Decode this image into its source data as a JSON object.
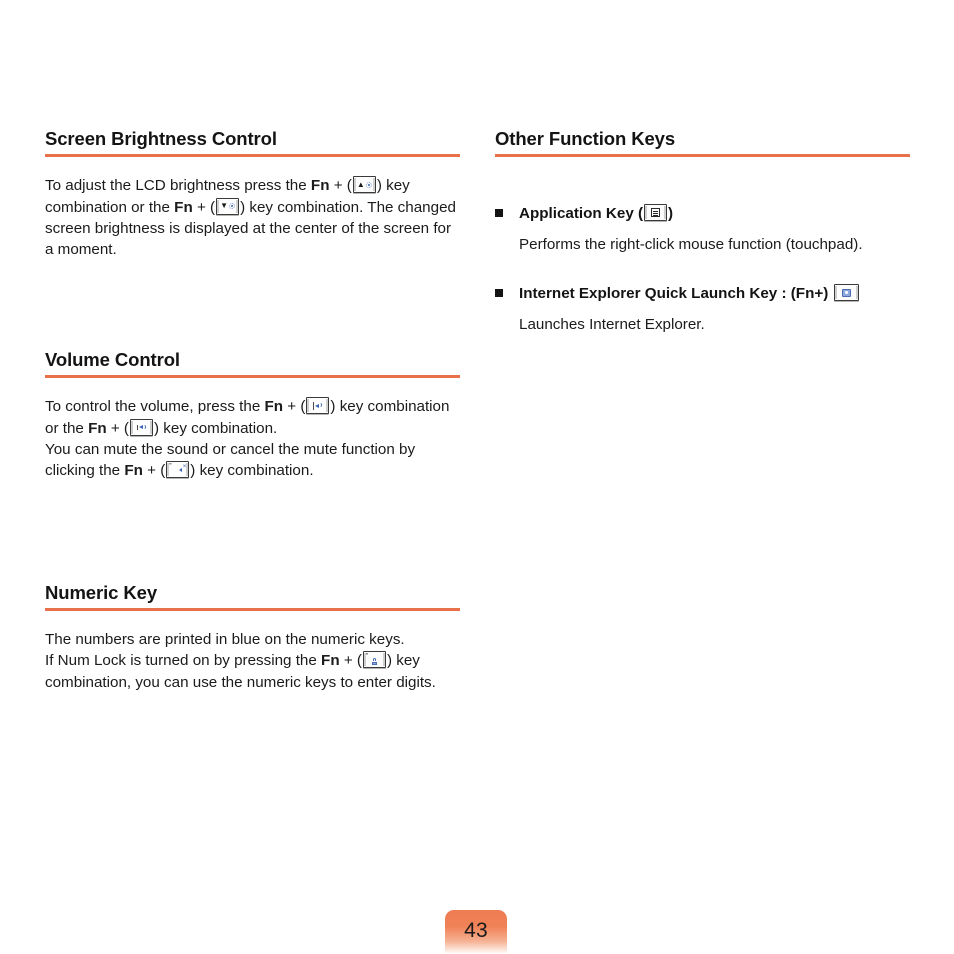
{
  "document": {
    "page_number": "43",
    "accent_color": "#e8714a",
    "text_color": "#1b1b1b"
  },
  "left_column": {
    "sections": [
      {
        "title": "Screen Brightness Control",
        "paragraph_parts": {
          "p1": "To adjust the LCD brightness press the ",
          "fn1": "Fn",
          "plus1": " + (",
          "key1_name": "brightness-up-key-icon",
          "mid": ") key combination or the ",
          "fn2": "Fn",
          "plus2": " + (",
          "key2_name": "brightness-down-key-icon",
          "tail": ") key combination. The changed screen brightness is displayed at the center of the screen for a moment."
        }
      },
      {
        "title": "Volume Control",
        "paragraph_parts": {
          "p1": "To control the volume, press the ",
          "fn1": "Fn",
          "plus1": " + (",
          "key1_name": "volume-up-key-icon",
          "mid": ") key combination or the ",
          "fn2": "Fn",
          "plus2": " + (",
          "key2_name": "volume-down-key-icon",
          "mid2": ") key combination.",
          "line3": "You can mute the sound or cancel the mute function by clicking the ",
          "fn3": "Fn",
          "plus3": " + (",
          "key3_name": "mute-key-icon",
          "tail": ") key combination."
        }
      },
      {
        "title": "Numeric Key",
        "paragraph_parts": {
          "p1": "The numbers are printed in blue on the numeric keys.",
          "p2": "If Num Lock is turned on by pressing the ",
          "fn1": "Fn",
          "plus1": " + (",
          "key1_name": "num-lock-key-icon",
          "tail": ") key combination, you can use the numeric keys to enter digits."
        }
      }
    ]
  },
  "right_column": {
    "section": {
      "title": "Other Function Keys",
      "bullets": [
        {
          "title": "Application Key (",
          "title_close": ")",
          "key_name": "application-key-icon",
          "description": "Performs the right-click mouse function (touchpad)."
        },
        {
          "title": "Internet Explorer Quick Launch Key : (Fn+) ",
          "title_close": "",
          "key_name": "internet-explorer-key-icon",
          "description": "Launches Internet Explorer."
        }
      ]
    }
  }
}
